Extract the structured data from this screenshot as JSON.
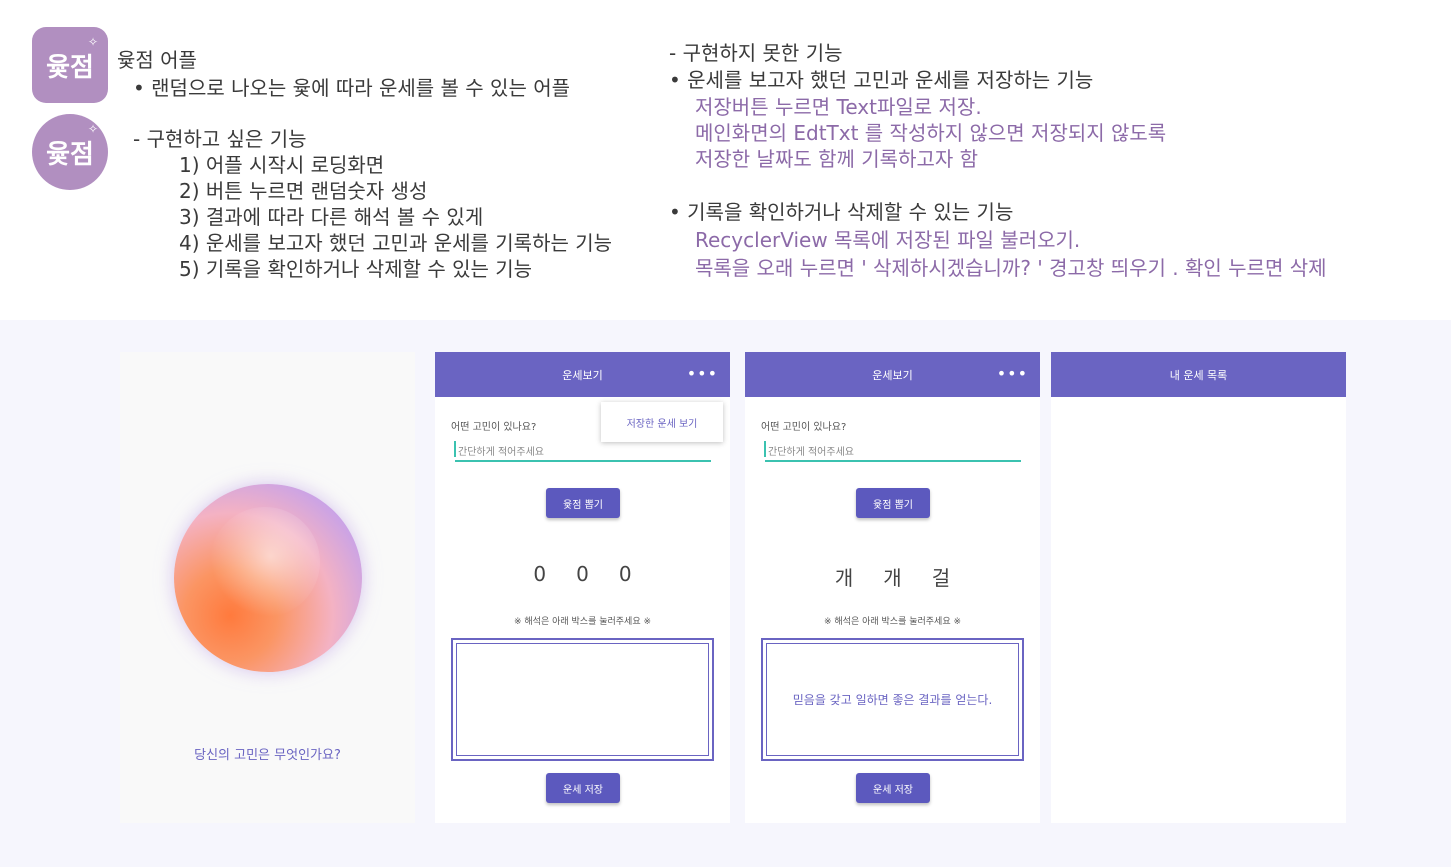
{
  "logo_text": "윷점",
  "left_text": {
    "app_name": "윷점 어플",
    "app_desc": "• 랜덤으로 나오는 윷에 따라 운세를 볼 수 있는 어플",
    "wanted_title": "- 구현하고 싶은 기능",
    "wanted_items": [
      "1) 어플 시작시 로딩화면",
      "2) 버튼 누르면 랜덤숫자 생성",
      "3) 결과에 따라 다른 해석 볼 수 있게",
      "4) 운세를 보고자 했던 고민과 운세를 기록하는 기능",
      "5) 기록을 확인하거나 삭제할 수 있는 기능"
    ]
  },
  "right_text": {
    "not_done_title": "- 구현하지 못한 기능",
    "feature1_title": "• 운세를 보고자 했던 고민과 운세를 저장하는 기능",
    "feature1_details": [
      "저장버튼 누르면 Text파일로 저장.",
      "메인화면의 EdtTxt 를 작성하지 않으면 저장되지 않도록",
      "저장한 날짜도 함께 기록하고자 함"
    ],
    "feature2_title": "• 기록을 확인하거나 삭제할 수 있는 기능",
    "feature2_details": [
      "RecyclerView 목록에 저장된 파일 불러오기.",
      "목록을 오래 누르면 ' 삭제하시겠습니까? ' 경고창 띄우기 . 확인 누르면 삭제"
    ]
  },
  "splash": {
    "question": "당신의 고민은 무엇인가요?"
  },
  "main1": {
    "title": "운세보기",
    "menu_dots": "•••",
    "popup_item": "저장한 운세 보기",
    "question_label": "어떤 고민이 있나요?",
    "input_placeholder": "간단하게 적어주세요",
    "draw_button": "윷점 뽑기",
    "results": [
      "0",
      "0",
      "0"
    ],
    "hint": "※ 해석은 아래 박스를 눌러주세요 ※",
    "interpretation": "",
    "save_button": "운세 저장"
  },
  "main2": {
    "title": "운세보기",
    "menu_dots": "•••",
    "question_label": "어떤 고민이 있나요?",
    "input_placeholder": "간단하게 적어주세요",
    "draw_button": "윷점 뽑기",
    "results": [
      "개",
      "개",
      "걸"
    ],
    "hint": "※ 해석은 아래 박스를 눌러주세요 ※",
    "interpretation": "믿음을 갖고 일하면 좋은 결과를 얻는다.",
    "save_button": "운세 저장"
  },
  "list_screen": {
    "title": "내 운세 목록"
  }
}
